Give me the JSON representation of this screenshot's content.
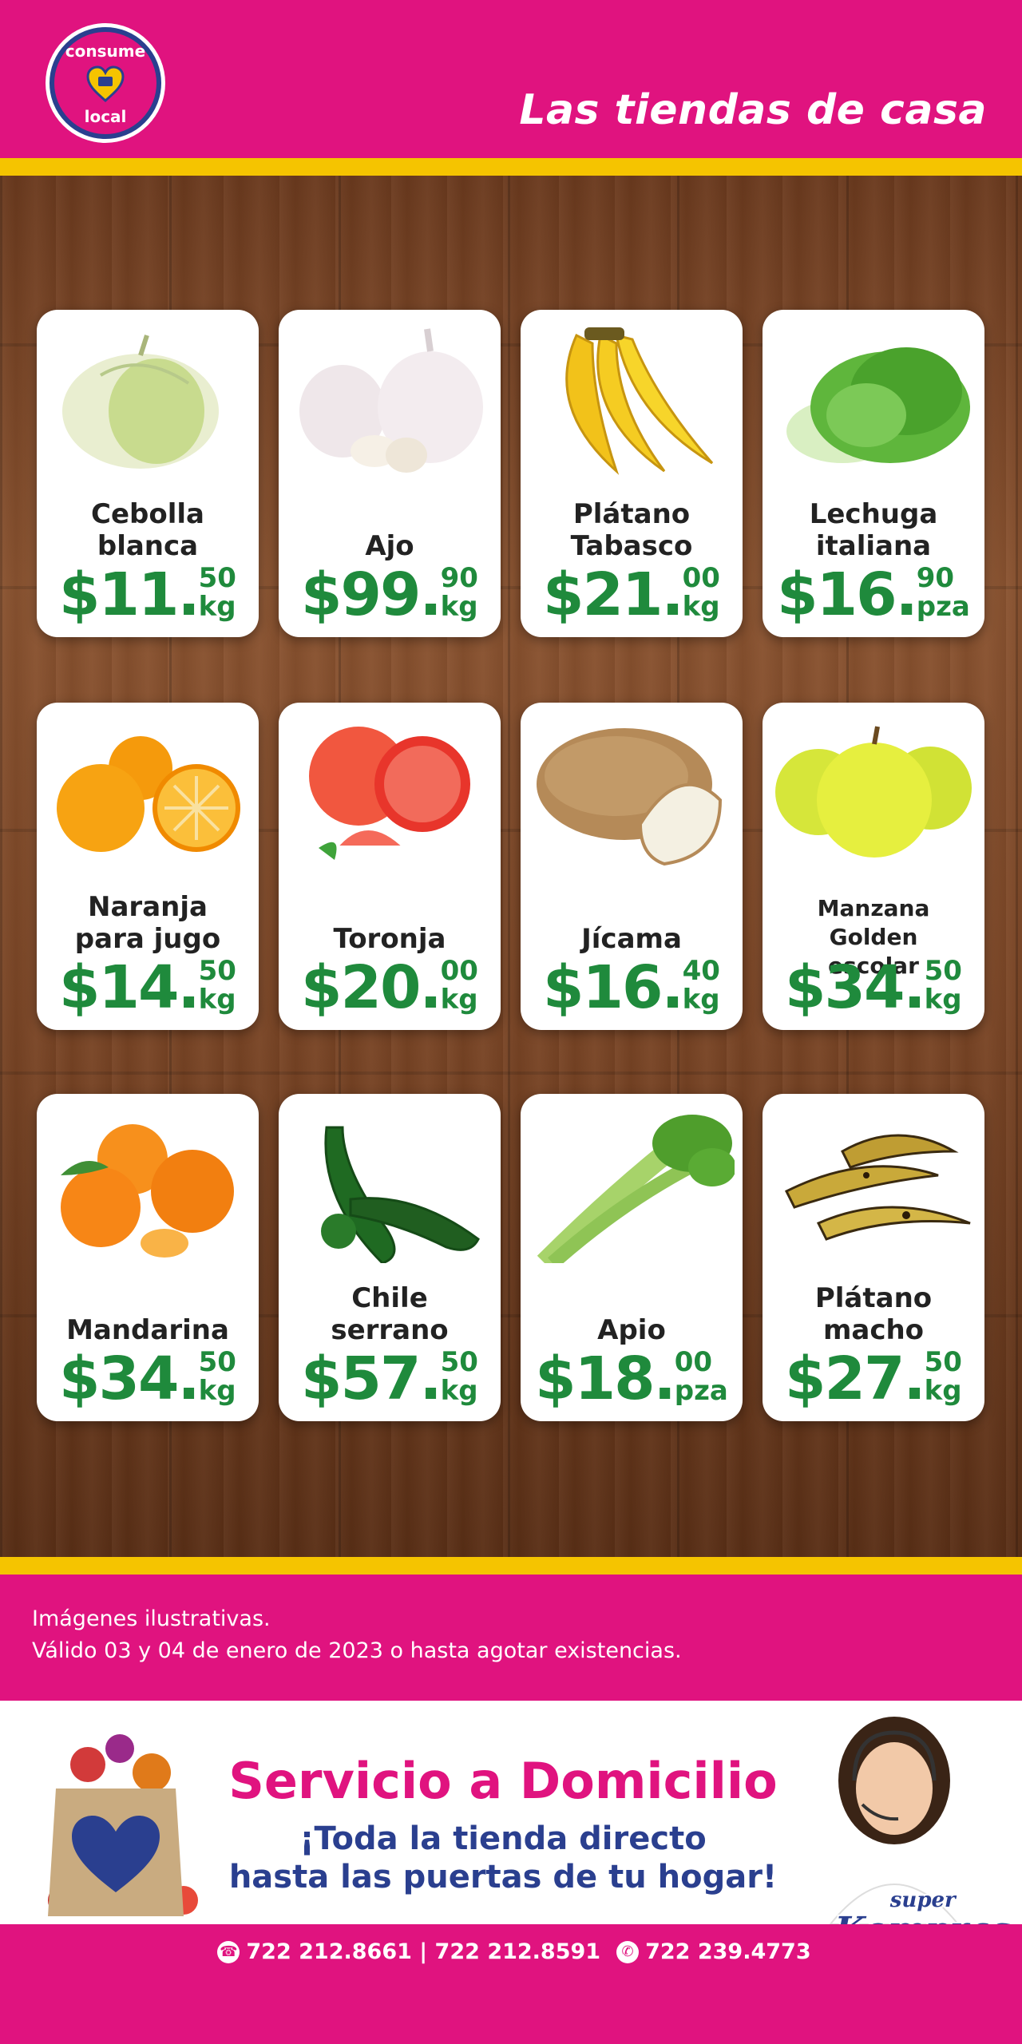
{
  "header": {
    "logo_top": "consume",
    "logo_bottom": "local",
    "tagline": "Las tiendas de casa"
  },
  "colors": {
    "pink": "#e0137f",
    "yellow": "#f5c400",
    "green": "#1f8a3c",
    "navy": "#2a3f8f"
  },
  "products": [
    {
      "name": "Cebolla blanca",
      "price": "$11.",
      "cents": "50",
      "unit": "kg",
      "icon": "onion-icon"
    },
    {
      "name": "Ajo",
      "price": "$99.",
      "cents": "90",
      "unit": "kg",
      "icon": "garlic-icon"
    },
    {
      "name": "Plátano Tabasco",
      "price": "$21.",
      "cents": "00",
      "unit": "kg",
      "icon": "banana-icon"
    },
    {
      "name": "Lechuga italiana",
      "price": "$16.",
      "cents": "90",
      "unit": "pza",
      "icon": "lettuce-icon"
    },
    {
      "name": "Naranja para jugo",
      "price": "$14.",
      "cents": "50",
      "unit": "kg",
      "icon": "orange-icon"
    },
    {
      "name": "Toronja",
      "price": "$20.",
      "cents": "00",
      "unit": "kg",
      "icon": "grapefruit-icon"
    },
    {
      "name": "Jícama",
      "price": "$16.",
      "cents": "40",
      "unit": "kg",
      "icon": "jicama-icon"
    },
    {
      "name": "Manzana Golden escolar",
      "price": "$34.",
      "cents": "50",
      "unit": "kg",
      "icon": "apple-icon"
    },
    {
      "name": "Mandarina",
      "price": "$34.",
      "cents": "50",
      "unit": "kg",
      "icon": "mandarin-icon"
    },
    {
      "name": "Chile serrano",
      "price": "$57.",
      "cents": "50",
      "unit": "kg",
      "icon": "chili-icon"
    },
    {
      "name": "Apio",
      "price": "$18.",
      "cents": "00",
      "unit": "pza",
      "icon": "celery-icon"
    },
    {
      "name": "Plátano macho",
      "price": "$27.",
      "cents": "50",
      "unit": "kg",
      "icon": "plantain-icon"
    }
  ],
  "info": {
    "line1": "Imágenes ilustrativas.",
    "line2": "Válido 03 y 04 de enero de 2023 o hasta agotar existencias."
  },
  "promo": {
    "title": "Servicio a Domicilio",
    "sub1": "¡Toda la tienda directo",
    "sub2": "hasta las puertas de tu hogar!",
    "brand_top": "super",
    "brand": "Kompras"
  },
  "contact": {
    "phones": "722 212.8661 | 722 212.8591",
    "whatsapp": "722 239.4773"
  }
}
